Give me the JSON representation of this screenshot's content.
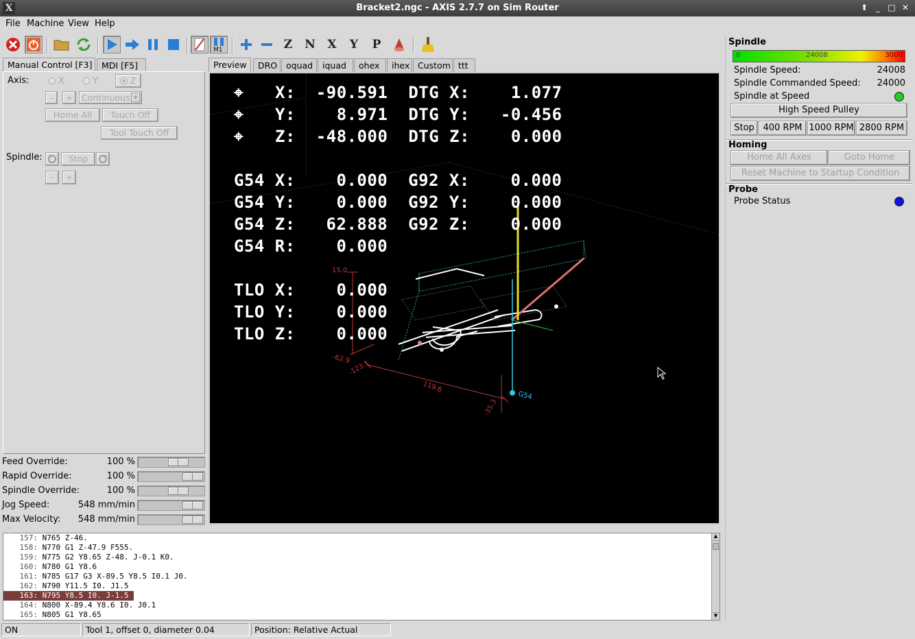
{
  "window": {
    "title": "Bracket2.ngc - AXIS 2.7.7 on Sim Router",
    "logo": "X"
  },
  "menu": [
    "File",
    "Machine",
    "View",
    "Help"
  ],
  "toolbar": {
    "letters": [
      "Z",
      "N",
      "X",
      "Y",
      "P"
    ],
    "m1_label": "M1",
    "icons": [
      "estop-icon",
      "power-icon",
      "open-file-icon",
      "reload-icon",
      "run-icon",
      "step-icon",
      "pause-icon",
      "stop-icon",
      "block-delete-icon",
      "optional-stop-icon",
      "zoom-in-icon",
      "zoom-out-icon",
      "view-z-icon",
      "view-z2-icon",
      "view-x-icon",
      "view-y-icon",
      "view-p-icon",
      "rotate-icon",
      "clear-plot-icon"
    ]
  },
  "left_tabs": [
    "Manual Control [F3]",
    "MDI [F5]"
  ],
  "manual": {
    "axis_label": "Axis:",
    "axes": [
      "X",
      "Y",
      "Z"
    ],
    "selected_axis": "Z",
    "jog_minus": "-",
    "jog_plus": "+",
    "jog_mode": "Continuous",
    "home_all": "Home All",
    "touch_off": "Touch Off",
    "tool_touch_off": "Tool Touch Off",
    "spindle_label": "Spindle:",
    "spindle_stop": "Stop",
    "spindle_minus": "-",
    "spindle_plus": "+"
  },
  "overrides": [
    {
      "name": "Feed Override:",
      "value": "100 %",
      "level": 0.68
    },
    {
      "name": "Rapid Override:",
      "value": "100 %",
      "level": 1.0
    },
    {
      "name": "Spindle Override:",
      "value": "100 %",
      "level": 0.68
    },
    {
      "name": "Jog Speed:",
      "value": "548 mm/min",
      "level": 1.0
    },
    {
      "name": "Max Velocity:",
      "value": "548 mm/min",
      "level": 1.0
    }
  ],
  "right_tabs": [
    "Preview",
    "DRO",
    "oquad",
    "iquad",
    "ohex",
    "ihex",
    "Custom",
    "ttt"
  ],
  "dro": {
    "lines": [
      {
        "marker": true,
        "text": "X:  -90.591  DTG X:    1.077"
      },
      {
        "marker": true,
        "text": "Y:    8.971  DTG Y:   -0.456"
      },
      {
        "marker": true,
        "text": "Z:  -48.000  DTG Z:    0.000"
      },
      {
        "marker": false,
        "text": ""
      },
      {
        "marker": false,
        "text": "G54 X:    0.000  G92 X:    0.000"
      },
      {
        "marker": false,
        "text": "G54 Y:    0.000  G92 Y:    0.000"
      },
      {
        "marker": false,
        "text": "G54 Z:   62.888  G92 Z:    0.000"
      },
      {
        "marker": false,
        "text": "G54 R:    0.000"
      },
      {
        "marker": false,
        "text": ""
      },
      {
        "marker": false,
        "text": "TLO X:    0.000"
      },
      {
        "marker": false,
        "text": "TLO Y:    0.000"
      },
      {
        "marker": false,
        "text": "TLO Z:    0.000"
      }
    ],
    "dim_labels": [
      "15.0",
      "-62.9",
      "-123.1",
      "119.6",
      "-35.3"
    ],
    "origin_label": "G54"
  },
  "spindle_panel": {
    "title": "Spindle",
    "bar": {
      "min": "0",
      "mid": "24008",
      "max": "3000"
    },
    "speed_label": "Spindle Speed:",
    "speed_value": "24008",
    "cmd_label": "Spindle Commanded Speed:",
    "cmd_value": "24000",
    "at_speed_label": "Spindle at Speed",
    "pulley_btn": "High Speed Pulley",
    "rpm_buttons": [
      "Stop",
      "400 RPM",
      "1000 RPM",
      "2800 RPM"
    ],
    "at_speed_color": "#22cc22"
  },
  "homing": {
    "title": "Homing",
    "home_all": "Home All Axes",
    "goto_home": "Goto Home",
    "reset": "Reset Machine to Startup Condition"
  },
  "probe": {
    "title": "Probe",
    "status_label": "Probe Status",
    "color": "#1010e0"
  },
  "gcode": [
    {
      "n": "157:",
      "code": "N765 Z-46."
    },
    {
      "n": "158:",
      "code": "N770 G1 Z-47.9 F555."
    },
    {
      "n": "159:",
      "code": "N775 G2 Y8.65 Z-48. J-0.1 K0."
    },
    {
      "n": "160:",
      "code": "N780 G1 Y8.6"
    },
    {
      "n": "161:",
      "code": "N785 G17 G3 X-89.5 Y8.5 I0.1 J0."
    },
    {
      "n": "162:",
      "code": "N790 Y11.5 I0. J1.5"
    },
    {
      "n": "163:",
      "code": "N795 Y8.5 I0. J-1.5"
    },
    {
      "n": "164:",
      "code": "N800 X-89.4 Y8.6 I0. J0.1"
    },
    {
      "n": "165:",
      "code": "N805 G1 Y8.65"
    }
  ],
  "current_line_index": 6,
  "status": {
    "state": "ON",
    "tool": "Tool 1, offset 0, diameter 0.04",
    "position": "Position: Relative Actual"
  }
}
